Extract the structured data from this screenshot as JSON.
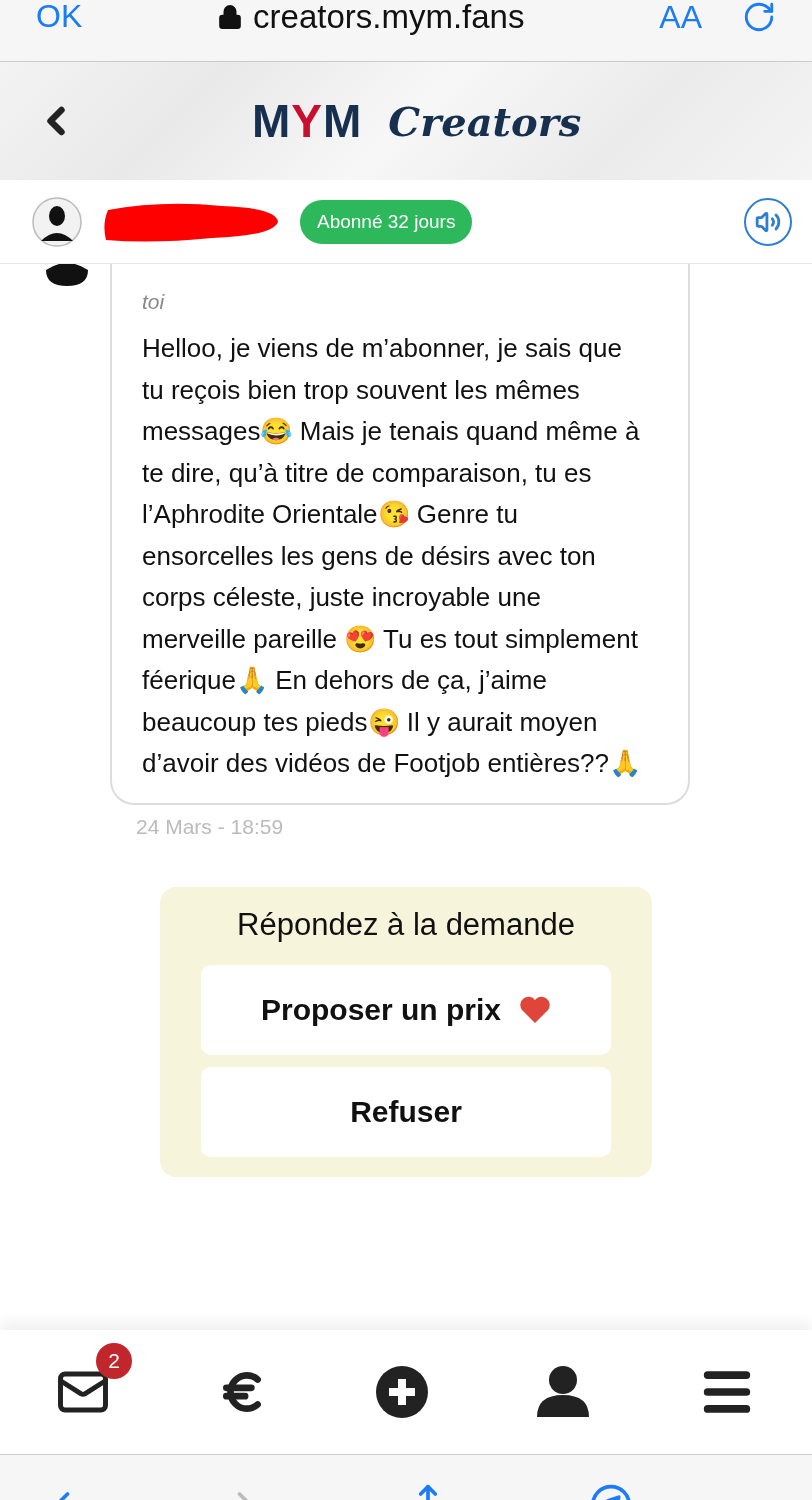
{
  "browser": {
    "done": "OK",
    "url": "creators.mym.fans",
    "text_size": "AA"
  },
  "header": {
    "logo": [
      {
        "text": "M",
        "color": "#17304f"
      },
      {
        "text": "Y",
        "color": "#c8102e"
      },
      {
        "text": "M",
        "color": "#17304f"
      }
    ],
    "logo_suffix": "Creators"
  },
  "subscriber": {
    "badge": "Abonné 32 jours"
  },
  "message": {
    "sender_note": "toi",
    "text": "Helloo, je viens de m’abonner, je sais que tu reçois bien trop souvent les mêmes messages😂 Mais je tenais quand même à te dire, qu’à titre de comparaison, tu es l’Aphrodite Orientale😘 Genre tu ensorcelles les gens de désirs avec ton corps céleste, juste incroyable une merveille pareille 😍 Tu es tout simplement féerique🙏 En dehors de ça, j’aime beaucoup tes pieds😜 Il y aurait moyen d’avoir des vidéos de Footjob entières??🙏",
    "time": "24 Mars - 18:59"
  },
  "request": {
    "title": "Répondez à la demande",
    "buttons": [
      {
        "label": "Proposer un prix",
        "kind": "heart"
      },
      {
        "label": "Refuser",
        "kind": "plain"
      }
    ]
  },
  "nav": [
    {
      "kind": "mail",
      "badge": "2"
    },
    {
      "kind": "euro"
    },
    {
      "kind": "plus"
    },
    {
      "kind": "user"
    },
    {
      "kind": "menu"
    }
  ]
}
